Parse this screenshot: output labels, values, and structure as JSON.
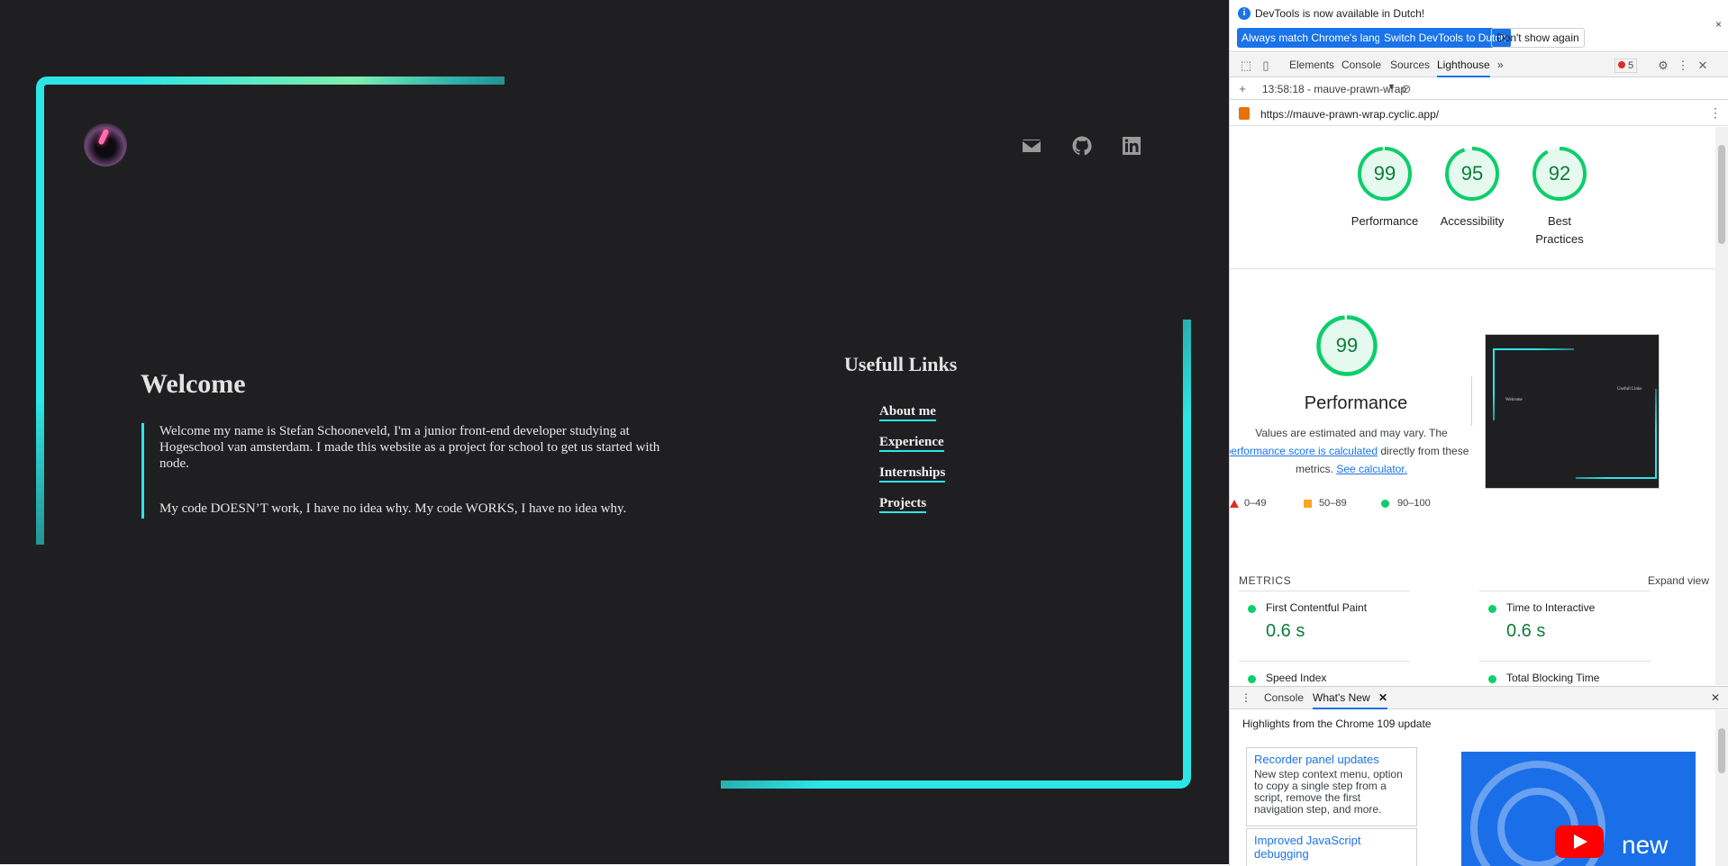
{
  "site": {
    "welcome_title": "Welcome",
    "intro_text": "Welcome my name is Stefan Schooneveld, I'm a junior front-end developer studying at Hogeschool van amsterdam. I made this website as a project for school to get us started with node.",
    "quote_text": "My code DOESN’T work, I have no idea why. My code WORKS, I have no idea why.",
    "links_title": "Usefull Links",
    "links": [
      "About me",
      "Experience",
      "Internships",
      "Projects"
    ],
    "social_icons": [
      "mail-icon",
      "github-icon",
      "linkedin-icon"
    ],
    "accent_color": "#2ce6e6",
    "accent_color_2": "#8ff0a0",
    "background_color": "#1f1f21"
  },
  "devtools": {
    "infobar": {
      "text": "DevTools is now available in Dutch!",
      "btn_match": "Always match Chrome's language",
      "btn_switch": "Switch DevTools to Dutch",
      "btn_dont_show": "Don't show again",
      "close": "×"
    },
    "tabs": [
      "Elements",
      "Console",
      "Sources",
      "Lighthouse"
    ],
    "active_tab": "Lighthouse",
    "more_tabs": "»",
    "error_count": "5",
    "report_selector": "13:58:18 - mauve-prawn-wrap",
    "report_url": "https://mauve-prawn-wrap.cyclic.app/",
    "scores": [
      {
        "label": "Performance",
        "value": "99"
      },
      {
        "label": "Accessibility",
        "value": "95"
      },
      {
        "label": "Best Practices",
        "value": "92"
      }
    ],
    "best_practices_line1": "Best",
    "best_practices_line2": "Practices",
    "performance": {
      "score": "99",
      "title": "Performance",
      "desc_1": "Values are estimated and may vary. The",
      "desc_link": "performance score is calculated",
      "desc_2": "directly from these",
      "desc_3": "metrics.",
      "calc_link": "See calculator.",
      "legend": [
        "0–49",
        "50–89",
        "90–100"
      ]
    },
    "thumbnail": {
      "title": "Welcome",
      "links_title": "Usefull Links"
    },
    "metrics_header": "METRICS",
    "expand_view": "Expand view",
    "metrics": [
      {
        "name": "First Contentful Paint",
        "value": "0.6 s"
      },
      {
        "name": "Time to Interactive",
        "value": "0.6 s"
      },
      {
        "name": "Speed Index",
        "value": ""
      },
      {
        "name": "Total Blocking Time",
        "value": ""
      }
    ],
    "drawer": {
      "tabs": [
        "Console",
        "What's New"
      ],
      "active_tab": "What's New",
      "headline": "Highlights from the Chrome 109 update",
      "cards": [
        {
          "title": "Recorder panel updates",
          "text": "New step context menu, option to copy a single step from a script, remove the first navigation step, and more."
        },
        {
          "title": "Improved JavaScript debugging",
          "text": ""
        }
      ],
      "video_text": "new"
    },
    "colors": {
      "good": "#0cce6b",
      "good_text": "#0c7c3a",
      "average": "#f5a623",
      "poor": "#d93025",
      "link": "#1a73e8"
    }
  }
}
